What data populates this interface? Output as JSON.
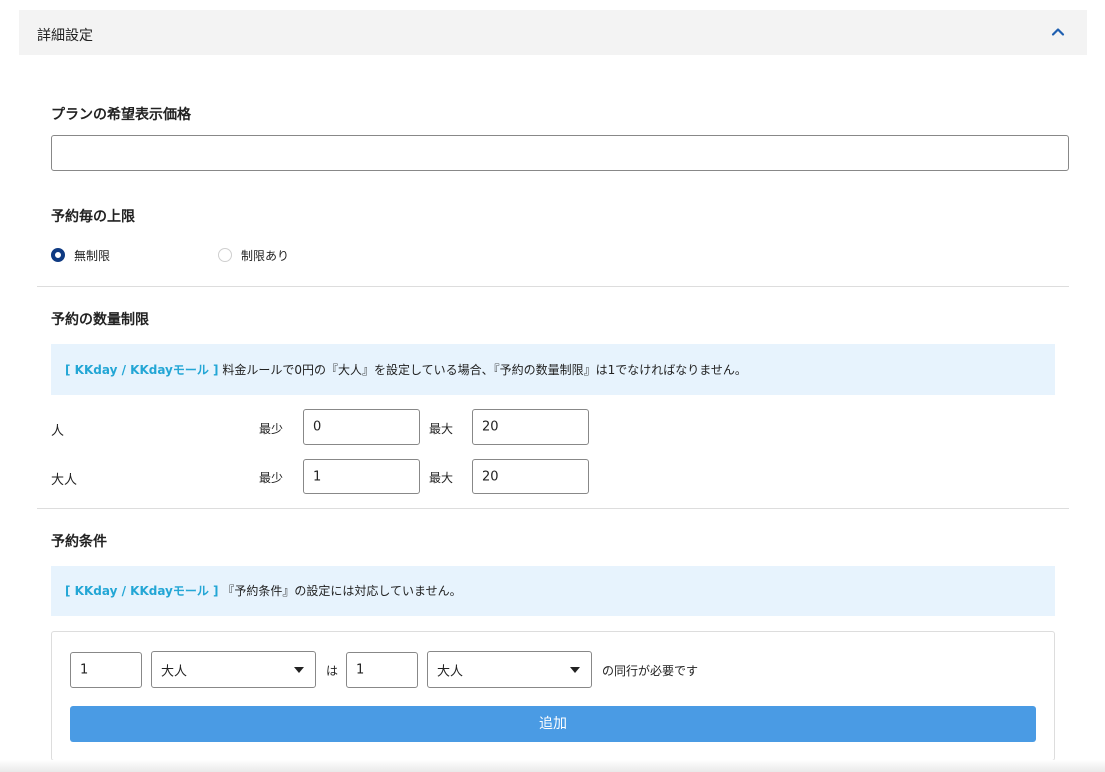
{
  "accordion": {
    "title": "詳細設定",
    "toggle_icon": "chevron-up-icon"
  },
  "display_price": {
    "title": "プランの希望表示価格",
    "value": ""
  },
  "booking_limit": {
    "title": "予約毎の上限",
    "options": [
      {
        "label": "無制限",
        "selected": true
      },
      {
        "label": "制限あり",
        "selected": false
      }
    ]
  },
  "quantity_limit": {
    "title": "予約の数量制限",
    "notice_brand": "[ KKday / KKdayモール ]",
    "notice_text": "料金ルールで0円の『大人』を設定している場合、『予約の数量制限』は1でなければなりません。",
    "min_label": "最少",
    "max_label": "最大",
    "rows": [
      {
        "name": "人",
        "min": "0",
        "max": "20"
      },
      {
        "name": "大人",
        "min": "1",
        "max": "20"
      }
    ]
  },
  "conditions": {
    "title": "予約条件",
    "notice_brand": "[ KKday / KKdayモール ]",
    "notice_text": "『予約条件』の設定には対応していません。",
    "rule": {
      "count1": "1",
      "type1": "大人",
      "connector": "は",
      "count2": "1",
      "type2": "大人",
      "suffix": "の同行が必要です"
    },
    "add_label": "追加"
  }
}
